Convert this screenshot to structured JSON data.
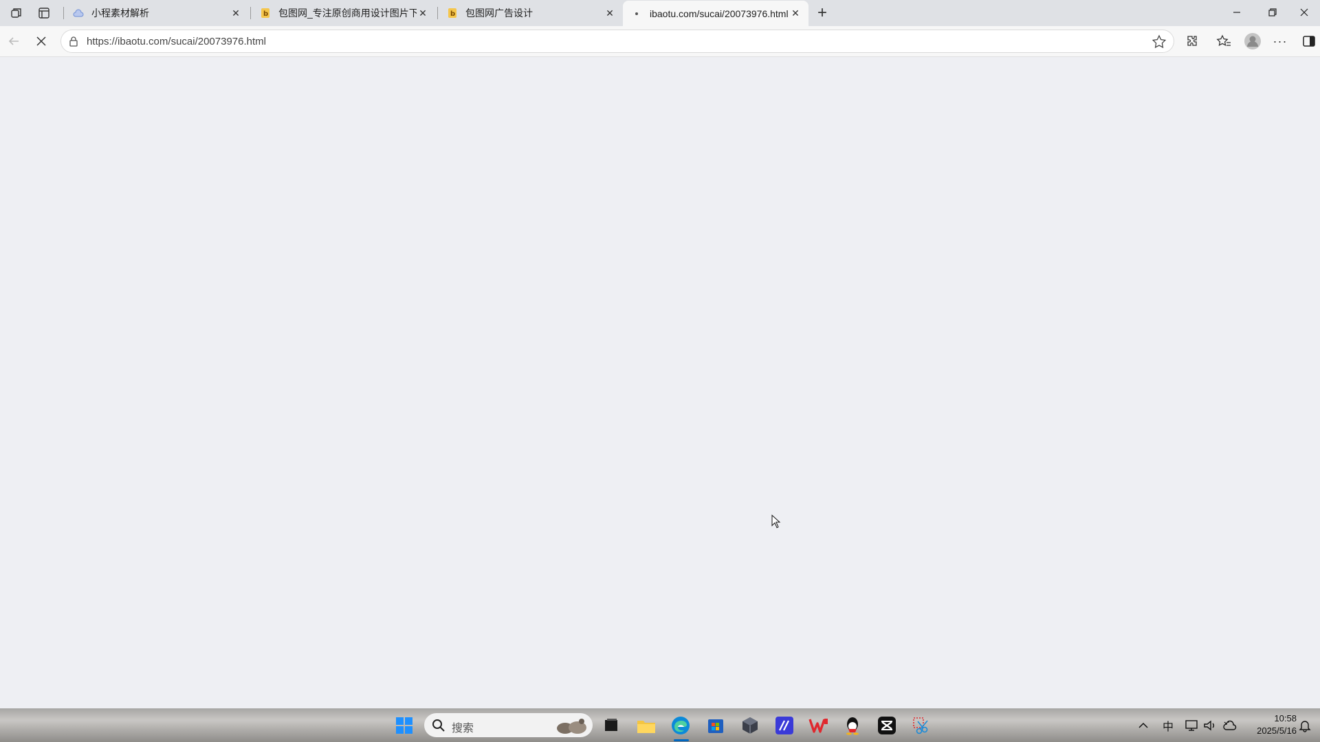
{
  "browser": {
    "tabs": [
      {
        "title": "小程素材解析",
        "favicon": "cloud-icon",
        "active": false
      },
      {
        "title": "包图网_专注原创商用设计图片下载",
        "favicon": "baotu-icon",
        "active": false
      },
      {
        "title": "包图网广告设计",
        "favicon": "baotu-icon",
        "active": false
      },
      {
        "title": "ibaotu.com/sucai/20073976.html",
        "favicon": "loading-dot-icon",
        "active": true
      }
    ],
    "address_bar": {
      "url": "https://ibaotu.com/sucai/20073976.html"
    },
    "page_state": "loading"
  },
  "taskbar": {
    "search_placeholder": "搜索",
    "clock": {
      "time": "10:58",
      "date": "2025/5/16"
    },
    "ime": "中"
  },
  "colors": {
    "accent": "#0067c0",
    "page_bg": "#eeeff3",
    "tabbar_bg": "#dfe1e5"
  }
}
